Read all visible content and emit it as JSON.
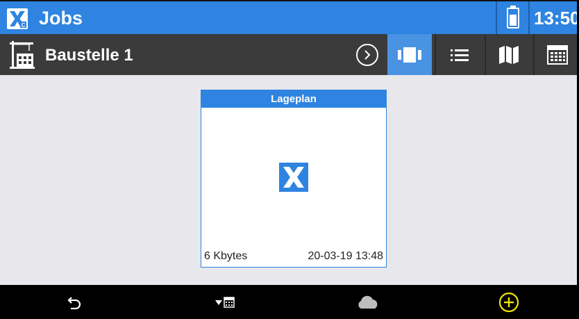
{
  "app": {
    "title": "Jobs",
    "time": "13:50",
    "battery_level": 0.6
  },
  "toolbar": {
    "site_title": "Baustelle 1",
    "buttons": [
      "next",
      "tiles-view",
      "list-view",
      "map-view",
      "calendar-view"
    ],
    "active_view": "tiles-view"
  },
  "card": {
    "title": "Lageplan",
    "size": "6 Kbytes",
    "date": "20-03-19 13:48"
  },
  "navbar": {
    "icons": [
      "back-icon",
      "calendar-filter-icon",
      "cloud-icon",
      "add-icon"
    ],
    "add_color": "#f2e600"
  },
  "colors": {
    "accent": "#2e84e0",
    "active_tab": "#4a93e3",
    "toolbar": "#3b3b3b",
    "background": "#e7e7ec"
  }
}
